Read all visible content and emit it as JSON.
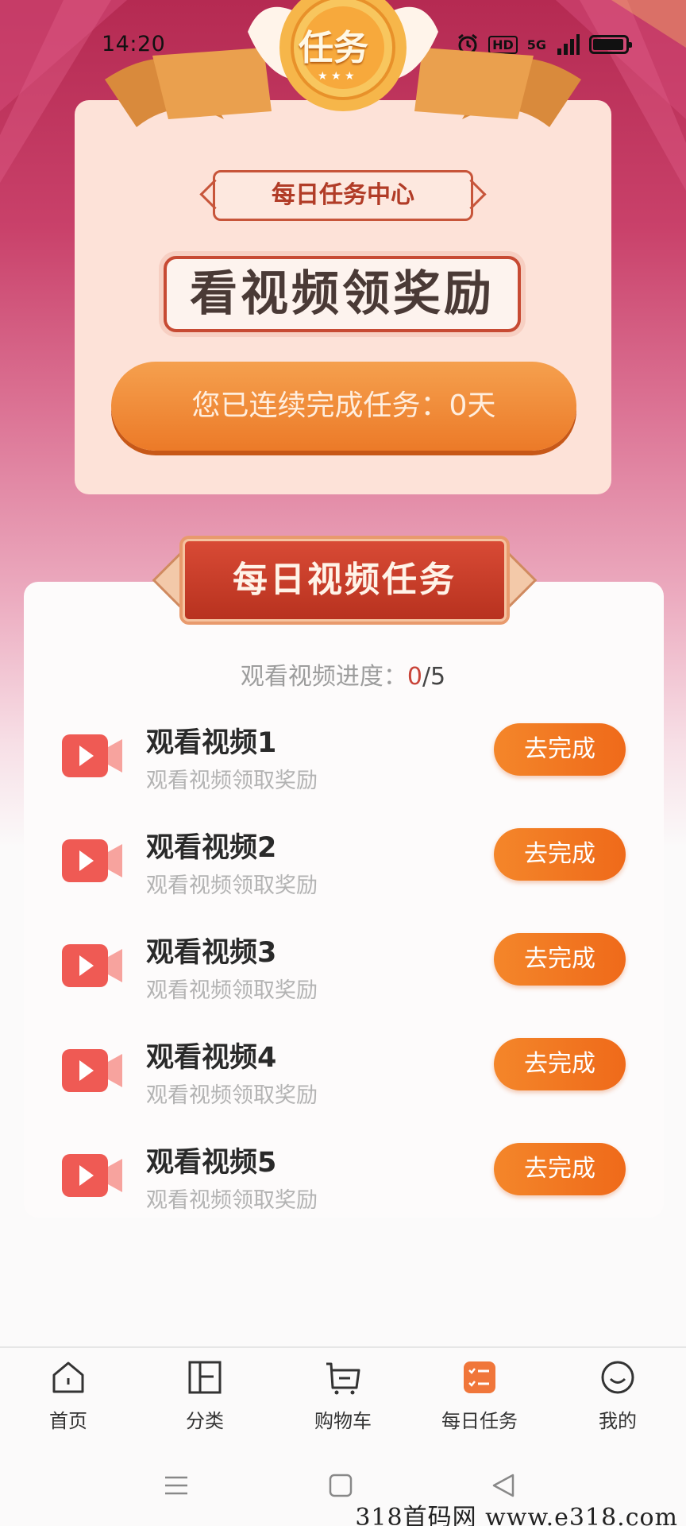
{
  "status": {
    "time": "14:20",
    "hd": "HD",
    "network": "5G"
  },
  "header": {
    "badge": "任务",
    "center_label": "每日任务中心",
    "title": "看视频领奖励",
    "streak": "您已连续完成任务：0天"
  },
  "section": {
    "title": "每日视频任务",
    "progress_label": "观看视频进度：",
    "progress_current": "0",
    "progress_sep": "/",
    "progress_total": "5"
  },
  "tasks": [
    {
      "title": "观看视频1",
      "subtitle": "观看视频领取奖励",
      "button": "去完成"
    },
    {
      "title": "观看视频2",
      "subtitle": "观看视频领取奖励",
      "button": "去完成"
    },
    {
      "title": "观看视频3",
      "subtitle": "观看视频领取奖励",
      "button": "去完成"
    },
    {
      "title": "观看视频4",
      "subtitle": "观看视频领取奖励",
      "button": "去完成"
    },
    {
      "title": "观看视频5",
      "subtitle": "观看视频领取奖励",
      "button": "去完成"
    }
  ],
  "nav": [
    {
      "label": "首页",
      "icon": "home-icon"
    },
    {
      "label": "分类",
      "icon": "category-icon"
    },
    {
      "label": "购物车",
      "icon": "cart-icon"
    },
    {
      "label": "每日任务",
      "icon": "task-list-icon",
      "active": true
    },
    {
      "label": "我的",
      "icon": "profile-icon"
    }
  ],
  "colors": {
    "accent": "#ef6a1a",
    "ribbon": "#c53a26",
    "active_nav": "#f0763a"
  },
  "watermark": "318首码网 www.e318.com"
}
